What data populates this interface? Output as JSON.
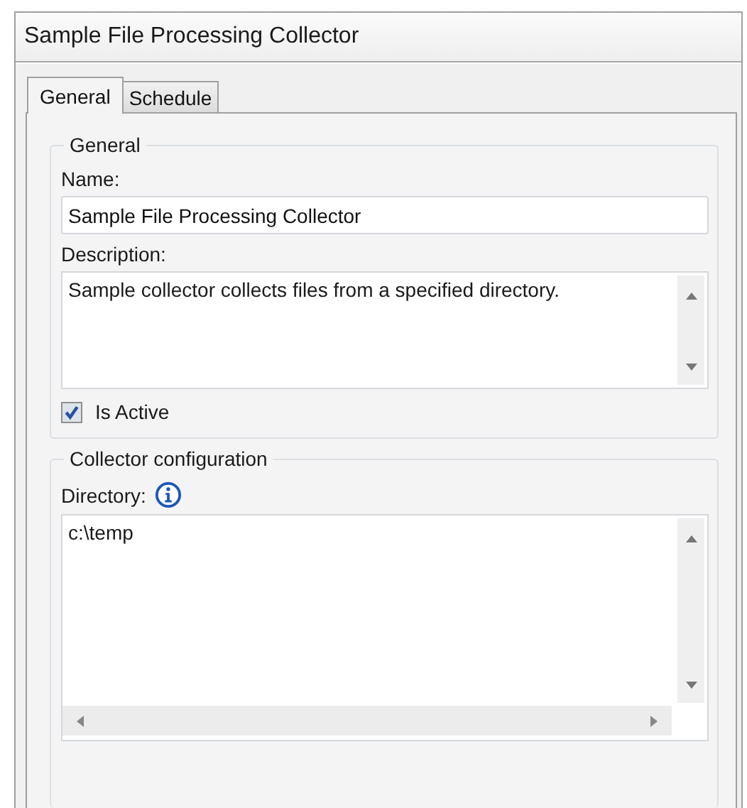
{
  "window": {
    "title": "Sample File Processing Collector"
  },
  "tabs": [
    {
      "label": "General",
      "selected": true
    },
    {
      "label": "Schedule",
      "selected": false
    }
  ],
  "general": {
    "legend": "General",
    "name_label": "Name:",
    "name_value": "Sample File Processing Collector",
    "description_label": "Description:",
    "description_value": "Sample collector collects files from a specified directory.",
    "is_active": {
      "label": "Is Active",
      "checked": true
    }
  },
  "collector_configuration": {
    "legend": "Collector configuration",
    "directory_label": "Directory:",
    "directory_value": "c:\\temp"
  }
}
